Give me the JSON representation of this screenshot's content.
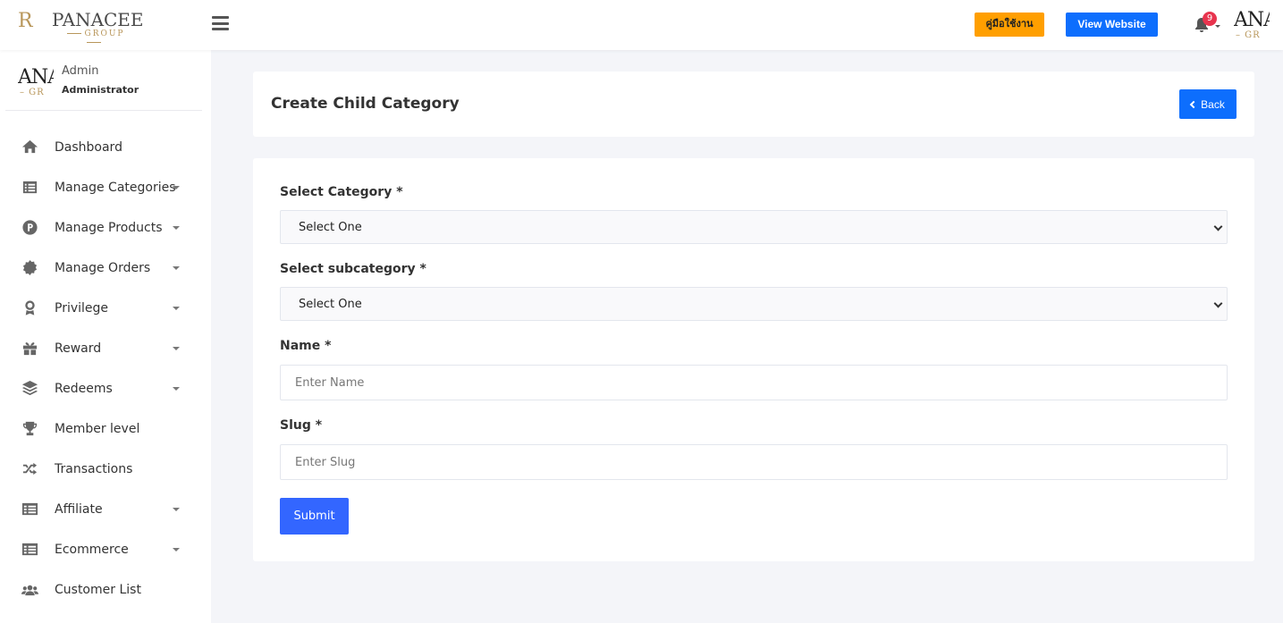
{
  "header": {
    "logo_monogram": "R",
    "logo_word": "PANACEE",
    "logo_sub": "GROUP",
    "manual_button": "คู่มือใช้งาน",
    "view_website_button": "View Website",
    "notification_count": "9",
    "avatar_text": "ANA",
    "avatar_sub": "– GR"
  },
  "sidebar": {
    "profile": {
      "avatar_text": "ANA",
      "avatar_sub": "– GR",
      "name": "Admin",
      "role": "Administrator"
    },
    "items": [
      {
        "label": "Dashboard",
        "icon": "home-icon",
        "has_submenu": false
      },
      {
        "label": "Manage Categories",
        "icon": "list-icon",
        "has_submenu": true
      },
      {
        "label": "Manage Products",
        "icon": "product-p-icon",
        "has_submenu": true
      },
      {
        "label": "Manage Orders",
        "icon": "badge-icon",
        "has_submenu": true
      },
      {
        "label": "Privilege",
        "icon": "award-icon",
        "has_submenu": true
      },
      {
        "label": "Reward",
        "icon": "gift-icon",
        "has_submenu": true
      },
      {
        "label": "Redeems",
        "icon": "layers-icon",
        "has_submenu": true
      },
      {
        "label": "Member level",
        "icon": "trophy-icon",
        "has_submenu": false
      },
      {
        "label": "Transactions",
        "icon": "shuffle-icon",
        "has_submenu": false
      },
      {
        "label": "Affiliate",
        "icon": "card-list-icon",
        "has_submenu": true
      },
      {
        "label": "Ecommerce",
        "icon": "card-list-icon",
        "has_submenu": true
      },
      {
        "label": "Customer List",
        "icon": "users-icon",
        "has_submenu": false
      }
    ]
  },
  "page": {
    "title": "Create Child Category",
    "back_button": "Back"
  },
  "form": {
    "category_label": "Select Category *",
    "category_value": "Select One",
    "subcategory_label": "Select subcategory *",
    "subcategory_value": "Select One",
    "name_label": "Name *",
    "name_placeholder": "Enter Name",
    "slug_label": "Slug *",
    "slug_placeholder": "Enter Slug",
    "submit_button": "Submit"
  },
  "colors": {
    "primary": "#0d6efd",
    "submit": "#3366ff",
    "manual_button": "#ff9f00",
    "badge": "#e8344e",
    "background": "#f4f5f9"
  }
}
